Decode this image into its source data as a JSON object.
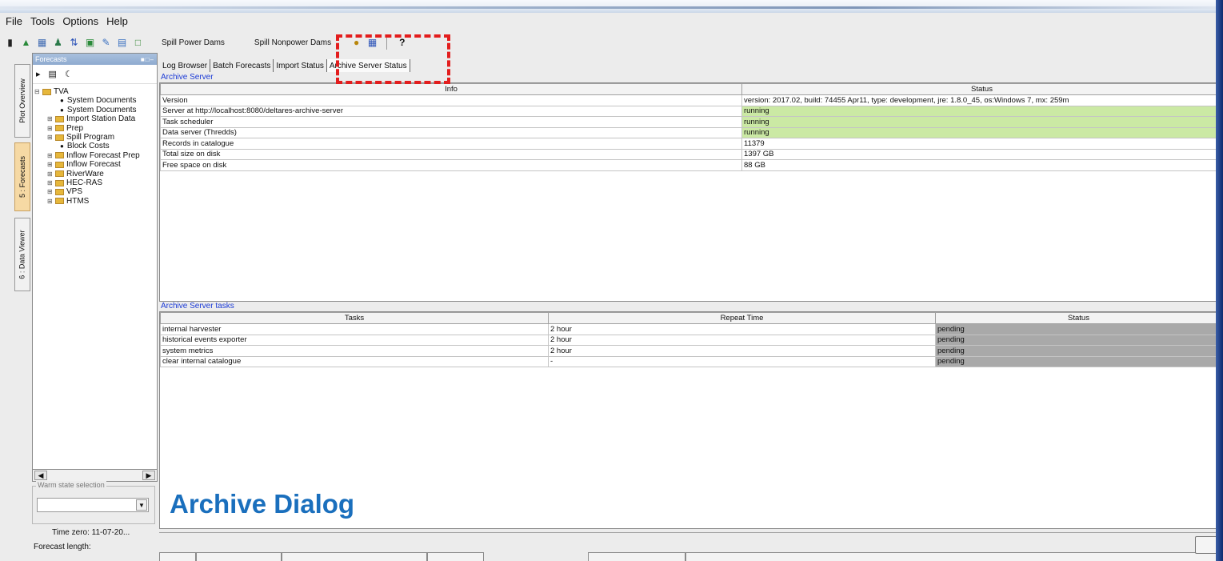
{
  "menu": [
    "File",
    "Tools",
    "Options",
    "Help"
  ],
  "toolbar": {
    "buttons": [
      "Spill Power Dams",
      "Spill Nonpower Dams"
    ],
    "help": "?"
  },
  "side_tabs": [
    "Plot Overview",
    "5 : Forecasts",
    "6 : Data Viewer"
  ],
  "forecasts_panel": {
    "title": "Forecasts",
    "tree": [
      {
        "label": "TVA",
        "kind": "root"
      },
      {
        "label": "System Documents",
        "kind": "leaf"
      },
      {
        "label": "System Documents",
        "kind": "leaf"
      },
      {
        "label": "Import Station Data",
        "kind": "folder"
      },
      {
        "label": "Prep",
        "kind": "folder"
      },
      {
        "label": "Spill Program",
        "kind": "folder"
      },
      {
        "label": "Block Costs",
        "kind": "leaf"
      },
      {
        "label": "Inflow Forecast Prep",
        "kind": "folder"
      },
      {
        "label": "Inflow Forecast",
        "kind": "folder"
      },
      {
        "label": "RiverWare",
        "kind": "folder"
      },
      {
        "label": "HEC-RAS",
        "kind": "folder"
      },
      {
        "label": "VPS",
        "kind": "folder"
      },
      {
        "label": "HTMS",
        "kind": "folder"
      }
    ],
    "warm_state_label": "Warm state selection",
    "time_zero": "Time zero:  11-07-20...",
    "forecast_length": "Forecast length:"
  },
  "tabs": [
    "Log Browser",
    "Batch Forecasts",
    "Import Status",
    "Archive Server Status"
  ],
  "archive_server": {
    "title": "Archive Server",
    "headers": [
      "Info",
      "Status"
    ],
    "rows": [
      [
        "Version",
        "version: 2017.02, build: 74455 Apr11, type: development, jre: 1.8.0_45, os:Windows 7, mx: 259m",
        ""
      ],
      [
        "Server at http://localhost:8080/deltares-archive-server",
        "running",
        "green"
      ],
      [
        "Task scheduler",
        "running",
        "green"
      ],
      [
        "Data server (Thredds)",
        "running",
        "green"
      ],
      [
        "Records in catalogue",
        "11379",
        ""
      ],
      [
        "Total size on disk",
        "1397 GB",
        ""
      ],
      [
        "Free space on disk",
        "88 GB",
        ""
      ]
    ]
  },
  "archive_tasks": {
    "title": "Archive Server tasks",
    "headers": [
      "Tasks",
      "Repeat Time",
      "Status"
    ],
    "rows": [
      [
        "internal harvester",
        "2 hour",
        "pending"
      ],
      [
        "historical events exporter",
        "2 hour",
        "pending"
      ],
      [
        "system metrics",
        "2 hour",
        "pending"
      ],
      [
        "clear internal catalogue",
        "-",
        "pending"
      ]
    ]
  },
  "caption": "Archive Dialog",
  "colors": {
    "running": "#cbe9a4",
    "pending": "#a9a9a9",
    "highlight": "#e31d1d",
    "caption": "#1a6fbd"
  }
}
